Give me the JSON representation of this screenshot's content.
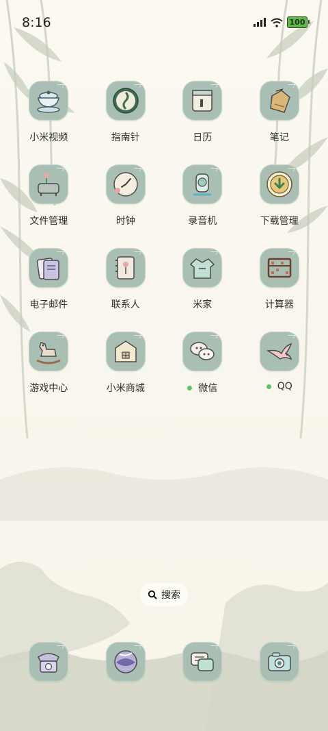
{
  "status_bar": {
    "time": "8:16",
    "battery": "100",
    "icons": [
      "signal-icon",
      "wifi-icon",
      "battery-icon"
    ]
  },
  "apps": [
    {
      "label": "小米视频",
      "icon": "tea-cup-icon"
    },
    {
      "label": "指南针",
      "icon": "compass-icon"
    },
    {
      "label": "日历",
      "icon": "calendar-icon"
    },
    {
      "label": "笔记",
      "icon": "note-tag-icon"
    },
    {
      "label": "文件管理",
      "icon": "incense-burner-icon"
    },
    {
      "label": "时钟",
      "icon": "clock-icon"
    },
    {
      "label": "录音机",
      "icon": "recorder-icon"
    },
    {
      "label": "下载管理",
      "icon": "download-icon"
    },
    {
      "label": "电子邮件",
      "icon": "mail-icon"
    },
    {
      "label": "联系人",
      "icon": "contacts-book-icon"
    },
    {
      "label": "米家",
      "icon": "robe-icon"
    },
    {
      "label": "计算器",
      "icon": "abacus-icon"
    },
    {
      "label": "游戏中心",
      "icon": "rocking-horse-icon"
    },
    {
      "label": "小米商城",
      "icon": "house-icon"
    },
    {
      "label": "微信",
      "icon": "chat-bubbles-icon",
      "notification_dot": true
    },
    {
      "label": "QQ",
      "icon": "swallow-icon",
      "notification_dot": true
    }
  ],
  "search": {
    "label": "搜索"
  },
  "dock": [
    {
      "icon": "telephone-icon"
    },
    {
      "icon": "browser-icon"
    },
    {
      "icon": "messages-icon"
    },
    {
      "icon": "camera-icon"
    }
  ],
  "colors": {
    "tile": "#a9bfb3",
    "background": "#faf8ee",
    "notification": "#5cc46a"
  }
}
